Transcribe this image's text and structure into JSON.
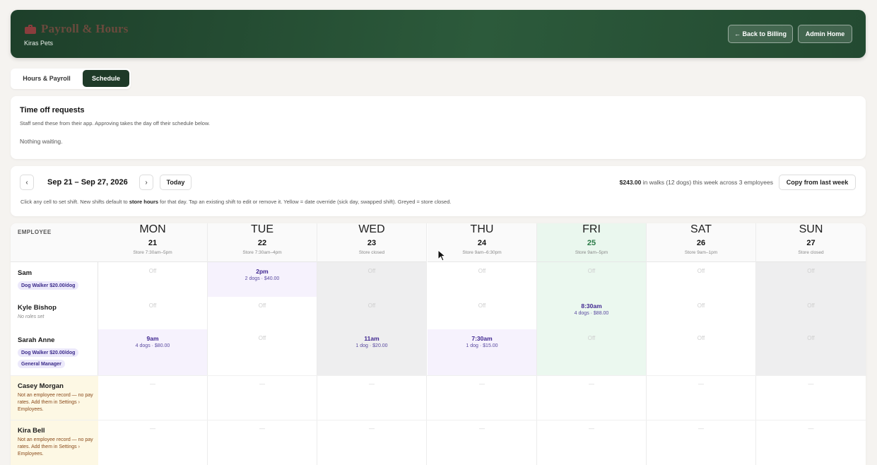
{
  "header": {
    "title": "Payroll & Hours",
    "subtitle": "Kiras Pets",
    "back_billing": "← Back to Billing",
    "admin_home": "Admin Home"
  },
  "tabs": [
    {
      "label": "Hours & Payroll",
      "active": false
    },
    {
      "label": "Schedule",
      "active": true
    }
  ],
  "time_off": {
    "title": "Time off requests",
    "description": "Staff send these from their app. Approving takes the day off their schedule below.",
    "empty_text": "Nothing waiting."
  },
  "week_bar": {
    "prev": "‹",
    "next": "›",
    "range": "Sep 21 – Sep 27, 2026",
    "today": "Today",
    "summary_amount": "$243.00",
    "summary_rest": " in walks (12 dogs) this week across 3 employees",
    "copy_button": "Copy from last week",
    "hint_a": "Click any cell to set shift. New shifts default to ",
    "hint_b": "store hours",
    "hint_c": " for that day. Tap an existing shift to edit or remove it. Yellow = date override (sick day, swapped shift). Greyed = store closed."
  },
  "grid": {
    "employee_header": "EMPLOYEE",
    "days": [
      {
        "dow": "MON",
        "num": "21",
        "hours": "Store 7:30am–5pm"
      },
      {
        "dow": "TUE",
        "num": "22",
        "hours": "Store 7:30am–4pm"
      },
      {
        "dow": "WED",
        "num": "23",
        "hours": "Store closed"
      },
      {
        "dow": "THU",
        "num": "24",
        "hours": "Store 9am–6:30pm"
      },
      {
        "dow": "FRI",
        "num": "25",
        "hours": "Store 9am–5pm"
      },
      {
        "dow": "SAT",
        "num": "26",
        "hours": "Store 9am–1pm"
      },
      {
        "dow": "SUN",
        "num": "27",
        "hours": "Store closed"
      }
    ],
    "employees": [
      {
        "name": "Sam",
        "badges": [
          "Dog Walker $20.00/dog"
        ]
      },
      {
        "name": "Kyle Bishop",
        "no_roles": "No roles set"
      },
      {
        "name": "Sarah Anne",
        "badges": [
          "Dog Walker $20.00/dog",
          "General Manager"
        ]
      },
      {
        "name": "Casey Morgan",
        "note": "Not an employee record — no pay rates. Add them in Settings › Employees."
      },
      {
        "name": "Kira Bell",
        "note": "Not an employee record — no pay rates. Add them in Settings › Employees."
      }
    ],
    "off_label": "Off",
    "dash_label": "—",
    "shifts": [
      {
        "row": 0,
        "day": 1,
        "time": "2pm",
        "detail": "2 dogs · $40.00"
      },
      {
        "row": 1,
        "day": 4,
        "time": "8:30am",
        "detail": "4 dogs · $88.00"
      },
      {
        "row": 2,
        "day": 0,
        "time": "9am",
        "detail": "4 dogs · $80.00"
      },
      {
        "row": 2,
        "day": 2,
        "time": "11am",
        "detail": "1 dog · $20.00"
      },
      {
        "row": 2,
        "day": 3,
        "time": "7:30am",
        "detail": "1 dog · $15.00"
      }
    ]
  }
}
